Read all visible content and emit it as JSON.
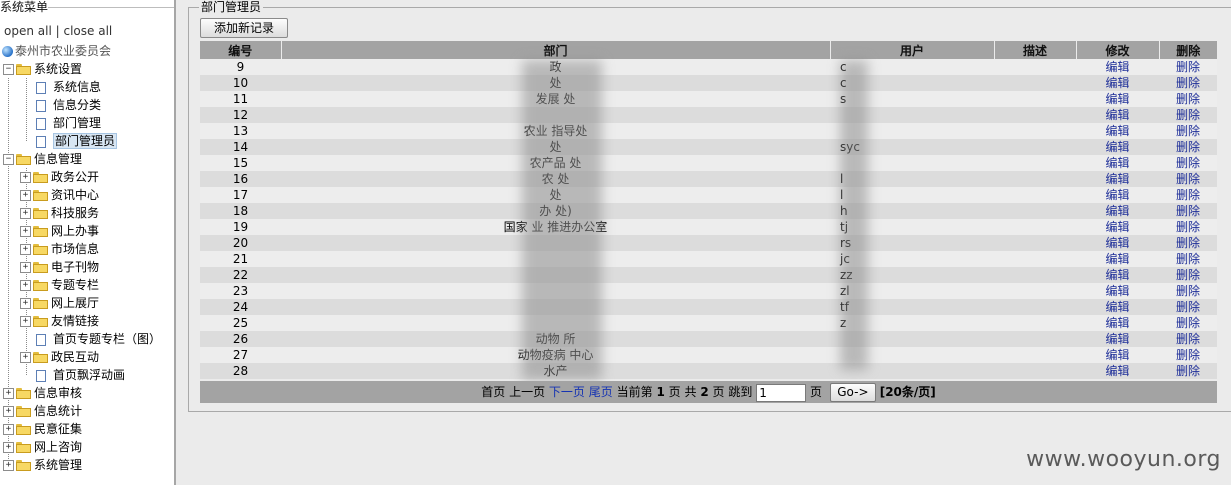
{
  "menu": {
    "title": "系统菜单",
    "open_all": "open all",
    "separator": "|",
    "close_all": "close all",
    "root": "泰州市农业委员会",
    "groups": [
      {
        "label": "系统设置",
        "expanded": true,
        "children": [
          "系统信息",
          "信息分类",
          "部门管理",
          "部门管理员"
        ]
      },
      {
        "label": "信息管理",
        "expanded": true,
        "children": [
          "政务公开",
          "资讯中心",
          "科技服务",
          "网上办事",
          "市场信息",
          "电子刊物",
          "专题专栏",
          "网上展厅",
          "友情链接",
          "首页专题专栏（图）",
          "首页飘浮动画"
        ]
      },
      {
        "label": "信息审核"
      },
      {
        "label": "信息统计"
      },
      {
        "label": "民意征集"
      },
      {
        "label": "网上咨询"
      },
      {
        "label": "系统管理"
      }
    ],
    "selected": "部门管理员"
  },
  "panel": {
    "legend": "部门管理员",
    "add_button": "添加新记录"
  },
  "table": {
    "headers": [
      "编号",
      "部门",
      "用户",
      "描述",
      "修改",
      "删除"
    ],
    "edit_label": "编辑",
    "delete_label": "删除",
    "rows": [
      {
        "id": "9",
        "dept": "政",
        "user": "c"
      },
      {
        "id": "10",
        "dept": "处",
        "user": "c"
      },
      {
        "id": "11",
        "dept": "发展 处",
        "user": "s"
      },
      {
        "id": "12",
        "dept": "",
        "user": ""
      },
      {
        "id": "13",
        "dept": "农业 指导处",
        "user": ""
      },
      {
        "id": "14",
        "dept": "处",
        "user": "syc"
      },
      {
        "id": "15",
        "dept": "农产品 处",
        "user": ""
      },
      {
        "id": "16",
        "dept": "农 处",
        "user": "l"
      },
      {
        "id": "17",
        "dept": "处",
        "user": "l"
      },
      {
        "id": "18",
        "dept": "办 处)",
        "user": "h"
      },
      {
        "id": "19",
        "dept": "国家 业 推进办公室",
        "user": "tj"
      },
      {
        "id": "20",
        "dept": "",
        "user": "rs"
      },
      {
        "id": "21",
        "dept": "",
        "user": "jc"
      },
      {
        "id": "22",
        "dept": "",
        "user": "zz"
      },
      {
        "id": "23",
        "dept": "",
        "user": "zl"
      },
      {
        "id": "24",
        "dept": "",
        "user": "tf"
      },
      {
        "id": "25",
        "dept": "",
        "user": "z"
      },
      {
        "id": "26",
        "dept": "动物 所",
        "user": ""
      },
      {
        "id": "27",
        "dept": "动物疫病 中心",
        "user": ""
      },
      {
        "id": "28",
        "dept": "水产",
        "user": ""
      }
    ]
  },
  "pager": {
    "first": "首页",
    "prev": "上一页",
    "next": "下一页",
    "last": "尾页",
    "current_prefix": "当前第",
    "current_page": "1",
    "page_word": "页",
    "total_prefix": "共",
    "total_pages": "2",
    "jump_to": "跳到",
    "jump_value": "1",
    "go_label": "Go->",
    "per_page": "[20条/页]"
  },
  "watermark": "www.wooyun.org",
  "colors": {
    "header_bg": "#a3a3a3",
    "row_odd": "#ededed",
    "row_even": "#dcdcdc",
    "link": "#1f2f99",
    "folder": "#f7d863"
  }
}
